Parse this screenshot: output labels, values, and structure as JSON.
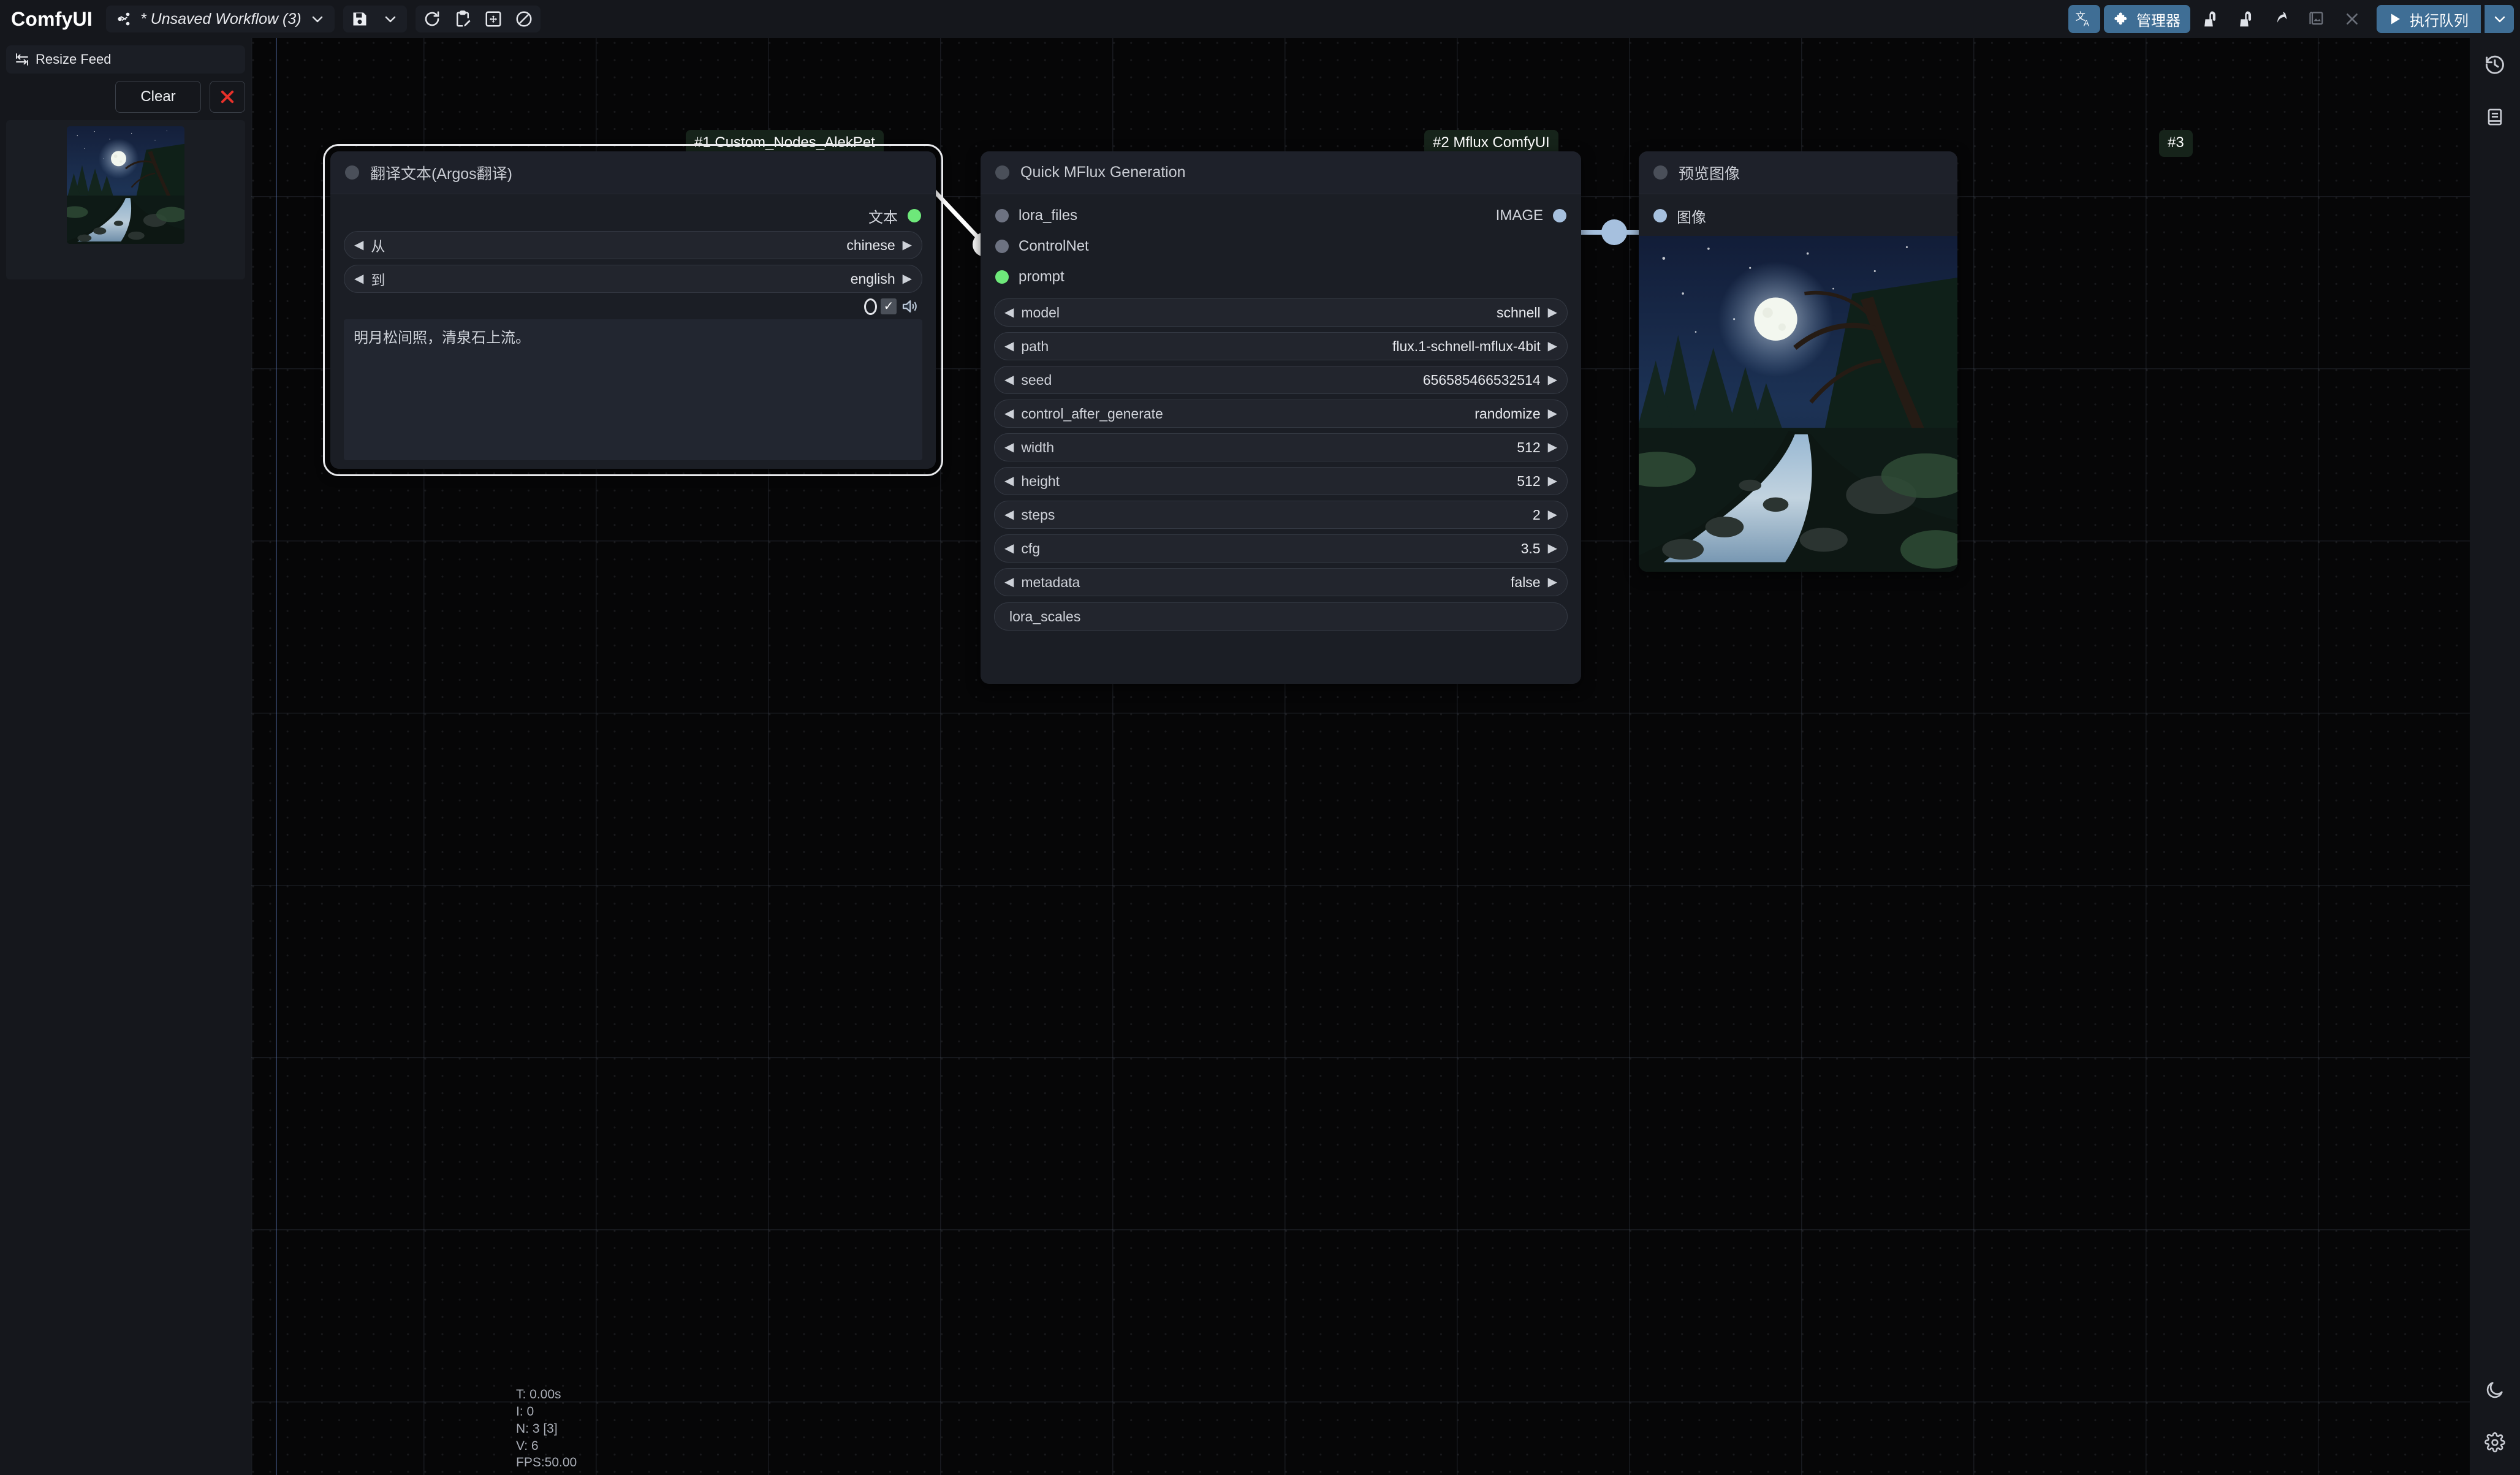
{
  "app": {
    "brand": "ComfyUI",
    "workflow_title": "* Unsaved Workflow (3)"
  },
  "toolbar": {
    "share_icon": "share-nodes-icon",
    "workflow_caret": "chevron-down-icon",
    "save_label": "save-icon",
    "save_caret": "chevron-down-icon",
    "refresh_label": "refresh-icon",
    "clipboard_label": "clipboard-edit-icon",
    "fit_label": "fit-view-icon",
    "disable_label": "no-entry-icon"
  },
  "right_toolbar": {
    "translate_label": "translate-icon",
    "manager_label": "管理器",
    "manager_icon": "puzzle-icon",
    "clean_vram_icon": "vacuum-icon",
    "clean_models_icon": "vacuum-icon",
    "share_icon": "arrow-share-icon",
    "gallery_icon": "images-icon",
    "close_icon": "x-icon",
    "queue_label": "执行队列",
    "queue_play_icon": "play-icon",
    "queue_caret": "chevron-down-icon"
  },
  "feed_panel": {
    "title": "Resize Feed",
    "title_icon": "resize-arrows-icon",
    "clear_label": "Clear",
    "close_icon": "red-x-icon",
    "thumbnail_alt": "moonlit-forest-stream"
  },
  "rail": {
    "history_icon": "history-clock-icon",
    "notes_icon": "book-icon",
    "theme_icon": "moon-icon",
    "settings_icon": "gear-icon"
  },
  "nodes": [
    {
      "badge": "#1 Custom_Nodes_AlekPet",
      "title": "翻译文本(Argos翻译)",
      "outputs": [
        {
          "label": "文本",
          "color": "green"
        }
      ],
      "widgets": [
        {
          "name": "从",
          "value": "chinese"
        },
        {
          "name": "到",
          "value": "english"
        }
      ],
      "text_value": "明月松间照，清泉石上流。",
      "tts": {
        "radio": "radio-off",
        "checkbox": "✓",
        "speaker": "speaker-icon"
      }
    },
    {
      "badge": "#2 Mflux ComfyUI",
      "title": "Quick MFlux Generation",
      "inputs": [
        {
          "label": "lora_files",
          "color": "grey"
        },
        {
          "label": "ControlNet",
          "color": "grey"
        },
        {
          "label": "prompt",
          "color": "green"
        }
      ],
      "outputs": [
        {
          "label": "IMAGE",
          "color": "blue"
        }
      ],
      "widgets": [
        {
          "name": "model",
          "value": "schnell"
        },
        {
          "name": "path",
          "value": "flux.1-schnell-mflux-4bit"
        },
        {
          "name": "seed",
          "value": "656585466532514"
        },
        {
          "name": "control_after_generate",
          "value": "randomize"
        },
        {
          "name": "width",
          "value": "512"
        },
        {
          "name": "height",
          "value": "512"
        },
        {
          "name": "steps",
          "value": "2"
        },
        {
          "name": "cfg",
          "value": "3.5"
        },
        {
          "name": "metadata",
          "value": "false"
        }
      ],
      "plain_widgets": [
        {
          "name": "lora_scales"
        }
      ]
    },
    {
      "badge": "#3",
      "title": "预览图像",
      "inputs": [
        {
          "label": "图像",
          "color": "blue"
        }
      ],
      "image_alt": "moonlit-forest-stream"
    }
  ],
  "stats": {
    "time": "T: 0.00s",
    "iterations": "I: 0",
    "nodes": "N: 3 [3]",
    "version": "V: 6",
    "fps": "FPS:50.00"
  },
  "colors": {
    "accent": "#3f6e95",
    "badge_bg": "#16231a",
    "node_bg": "#1b1e25",
    "canvas_bg": "#060607",
    "green_slot": "#6ee87a",
    "blue_slot": "#a6c0de",
    "danger": "#e8312a"
  }
}
